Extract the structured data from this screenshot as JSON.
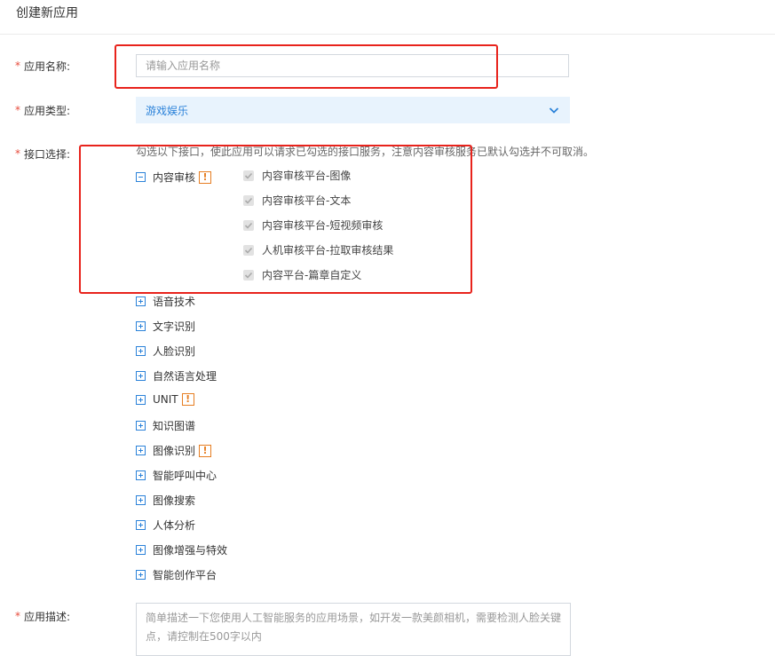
{
  "page": {
    "title": "创建新应用"
  },
  "form": {
    "required_mark": "*",
    "name": {
      "label": "应用名称:",
      "placeholder": "请输入应用名称",
      "value": ""
    },
    "type": {
      "label": "应用类型:",
      "selected": "游戏娱乐"
    },
    "api": {
      "label": "接口选择:",
      "hint": "勾选以下接口，使此应用可以请求已勾选的接口服务，注意内容审核服务已默认勾选并不可取消。",
      "expanded_group": {
        "label": "内容审核",
        "badge": "!",
        "children": [
          {
            "label": "内容审核平台-图像",
            "checked": true,
            "disabled": true
          },
          {
            "label": "内容审核平台-文本",
            "checked": true,
            "disabled": true
          },
          {
            "label": "内容审核平台-短视频审核",
            "checked": true,
            "disabled": true
          },
          {
            "label": "人机审核平台-拉取审核结果",
            "checked": true,
            "disabled": true
          },
          {
            "label": "内容平台-篇章自定义",
            "checked": true,
            "disabled": true
          }
        ]
      },
      "groups": [
        {
          "label": "语音技术",
          "badge": ""
        },
        {
          "label": "文字识别",
          "badge": ""
        },
        {
          "label": "人脸识别",
          "badge": ""
        },
        {
          "label": "自然语言处理",
          "badge": ""
        },
        {
          "label": "UNIT",
          "badge": "!"
        },
        {
          "label": "知识图谱",
          "badge": ""
        },
        {
          "label": "图像识别",
          "badge": "!"
        },
        {
          "label": "智能呼叫中心",
          "badge": ""
        },
        {
          "label": "图像搜索",
          "badge": ""
        },
        {
          "label": "人体分析",
          "badge": ""
        },
        {
          "label": "图像增强与特效",
          "badge": ""
        },
        {
          "label": "智能创作平台",
          "badge": ""
        }
      ]
    },
    "description": {
      "label": "应用描述:",
      "placeholder": "简单描述一下您使用人工智能服务的应用场景，如开发一款美颜相机，需要检测人脸关键点，请控制在500字以内"
    }
  },
  "colors": {
    "accent": "#2b82d9",
    "required": "#e74c3c",
    "highlight": "#e8231c",
    "warn": "#e67e22"
  }
}
